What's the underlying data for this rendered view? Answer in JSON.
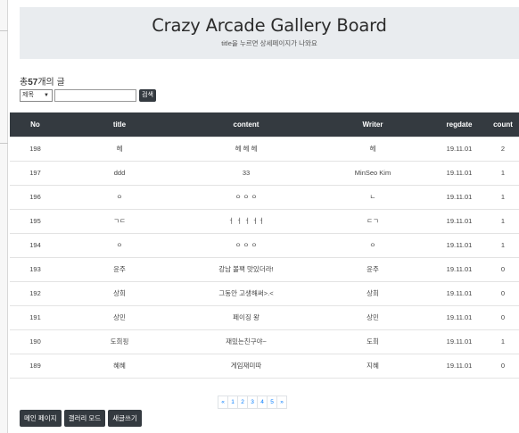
{
  "header": {
    "title": "Crazy Arcade Gallery Board",
    "subtitle": "title을 누르면 상세페이지가 나와요"
  },
  "summary": {
    "prefix": "총",
    "count": "57",
    "suffix": "개의 글"
  },
  "search": {
    "select_value": "제목",
    "input_value": "",
    "button_label": "검색"
  },
  "table": {
    "columns": [
      "No",
      "title",
      "content",
      "Writer",
      "regdate",
      "count"
    ],
    "rows": [
      [
        "198",
        "헤",
        "헤 헤 헤",
        "헤",
        "19.11.01",
        "2"
      ],
      [
        "197",
        "ddd",
        "33",
        "MinSeo Kim",
        "19.11.01",
        "1"
      ],
      [
        "196",
        "ㅇ",
        "ㅇ ㅇ ㅇ",
        "ㄴ",
        "19.11.01",
        "1"
      ],
      [
        "195",
        "ㄱㄷ",
        "ㅓ ㅓ ㅓ ㅓㅓ",
        "ㄷㄱ",
        "19.11.01",
        "1"
      ],
      [
        "194",
        "ㅇ",
        "ㅇ ㅇ ㅇ",
        "ㅇ",
        "19.11.01",
        "1"
      ],
      [
        "193",
        "윤주",
        "강남 볼팩 맛있더라!",
        "윤주",
        "19.11.01",
        "0"
      ],
      [
        "192",
        "상희",
        "그동안 고생해써>.<",
        "상희",
        "19.11.01",
        "0"
      ],
      [
        "191",
        "상민",
        "페이징 왕",
        "상민",
        "19.11.01",
        "0"
      ],
      [
        "190",
        "도희핑",
        "재밌는친구야~",
        "도희",
        "19.11.01",
        "1"
      ],
      [
        "189",
        "혜혜",
        "게임재미따",
        "지혜",
        "19.11.01",
        "0"
      ]
    ]
  },
  "pagination": [
    "«",
    "1",
    "2",
    "3",
    "4",
    "5",
    "»"
  ],
  "footer_buttons": [
    "메인 페이지",
    "갤러리 모드",
    "새글쓰기"
  ]
}
